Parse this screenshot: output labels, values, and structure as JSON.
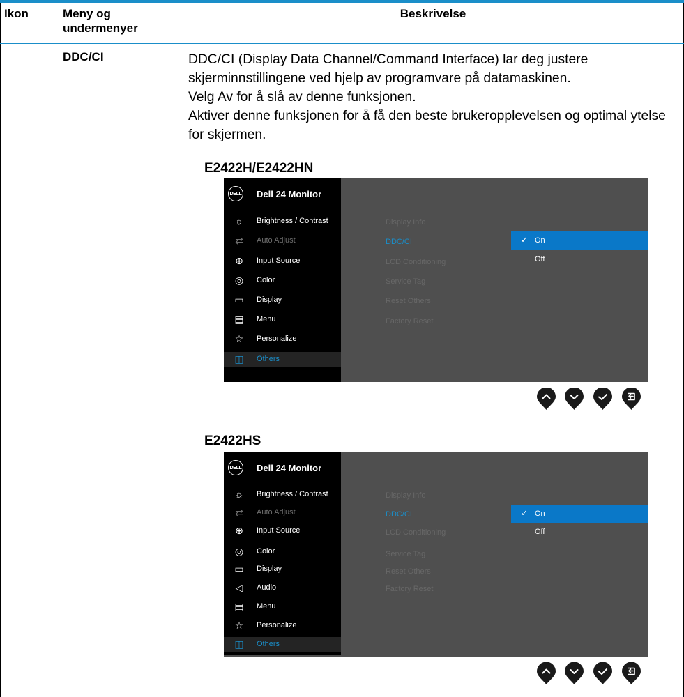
{
  "table": {
    "headers": [
      "Ikon",
      "Meny og undermenyer",
      "Beskrivelse"
    ],
    "row": {
      "menu": "DDC/CI",
      "description": [
        "DDC/CI (Display Data Channel/Command Interface) lar deg justere skjerminnstillingene ved hjelp av programvare på datamaskinen.",
        "Velg Av for å slå av denne funksjonen.",
        "Aktiver denne funksjonen for å få den beste brukeropplevelsen og optimal ytelse for skjermen."
      ]
    }
  },
  "osd1": {
    "model": "E2422H/E2422HN",
    "logo": "DELL",
    "title": "Dell 24 Monitor",
    "menu": [
      {
        "icon": "brightness-icon",
        "label": "Brightness / Contrast"
      },
      {
        "icon": "auto-adjust-icon",
        "label": "Auto Adjust"
      },
      {
        "icon": "input-source-icon",
        "label": "Input Source"
      },
      {
        "icon": "color-icon",
        "label": "Color"
      },
      {
        "icon": "display-icon",
        "label": "Display"
      },
      {
        "icon": "menu-icon",
        "label": "Menu"
      },
      {
        "icon": "star-icon",
        "label": "Personalize"
      },
      {
        "icon": "others-icon",
        "label": "Others"
      }
    ],
    "submenu": [
      "Display Info",
      "DDC/CI",
      "LCD Conditioning",
      "Service Tag",
      "Reset Others",
      "Factory Reset"
    ],
    "options": [
      "On",
      "Off"
    ],
    "selected_option": "On"
  },
  "osd2": {
    "model": "E2422HS",
    "logo": "DELL",
    "title": "Dell 24 Monitor",
    "menu": [
      {
        "icon": "brightness-icon",
        "label": "Brightness / Contrast"
      },
      {
        "icon": "auto-adjust-icon",
        "label": "Auto Adjust"
      },
      {
        "icon": "input-source-icon",
        "label": "Input Source"
      },
      {
        "icon": "color-icon",
        "label": "Color"
      },
      {
        "icon": "display-icon",
        "label": "Display"
      },
      {
        "icon": "audio-icon",
        "label": "Audio"
      },
      {
        "icon": "menu-icon",
        "label": "Menu"
      },
      {
        "icon": "star-icon",
        "label": "Personalize"
      },
      {
        "icon": "others-icon",
        "label": "Others"
      }
    ],
    "submenu": [
      "Display Info",
      "DDC/CI",
      "LCD Conditioning",
      "Service Tag",
      "Reset Others",
      "Factory Reset"
    ],
    "options": [
      "On",
      "Off"
    ],
    "selected_option": "On"
  },
  "nav_buttons": [
    "up-arrow-icon",
    "down-arrow-icon",
    "check-icon",
    "back-icon"
  ],
  "colors": {
    "accent": "#1a8ec9",
    "osd_bg": "#4f4f4f",
    "osd_sidebar": "#000000",
    "selected_option": "#0a78c8"
  }
}
